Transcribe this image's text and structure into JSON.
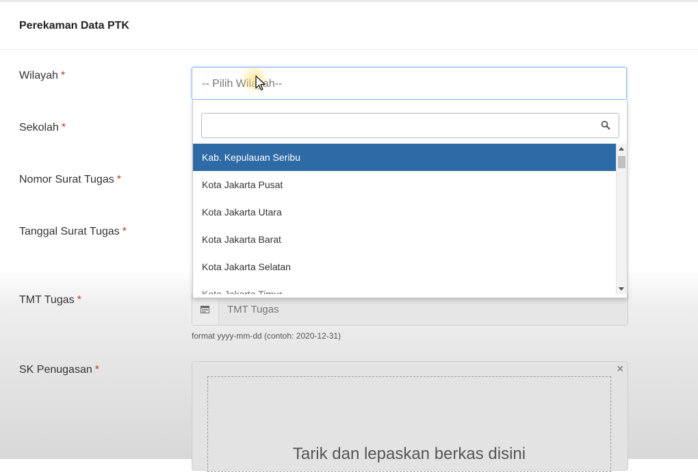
{
  "panel": {
    "title": "Perekaman Data PTK"
  },
  "form": {
    "required_mark": "*",
    "wilayah": {
      "label": "Wilayah",
      "placeholder": "-- Pilih Wilayah--"
    },
    "sekolah": {
      "label": "Sekolah"
    },
    "nomor_surat": {
      "label": "Nomor Surat Tugas"
    },
    "tanggal_surat": {
      "label": "Tanggal Surat Tugas"
    },
    "tmt": {
      "label": "TMT Tugas",
      "placeholder": "TMT Tugas",
      "help": "format yyyy-mm-dd (contoh: 2020-12-31)"
    },
    "sk": {
      "label": "SK Penugasan",
      "dropzone_text": "Tarik dan lepaskan berkas disini",
      "close_label": "×"
    }
  },
  "dropdown": {
    "search_value": "",
    "options": [
      "Kab. Kepulauan Seribu",
      "Kota Jakarta Pusat",
      "Kota Jakarta Utara",
      "Kota Jakarta Barat",
      "Kota Jakarta Selatan",
      "Kota Jakarta Timur"
    ],
    "highlighted_index": 0
  },
  "icons": {
    "search": "search-icon",
    "calendar": "calendar-icon",
    "close": "close-icon",
    "cursor": "mouse-cursor-icon"
  },
  "colors": {
    "highlight": "#2e6aa6",
    "required": "#c0392b",
    "focus_border": "#8fb7e6"
  }
}
